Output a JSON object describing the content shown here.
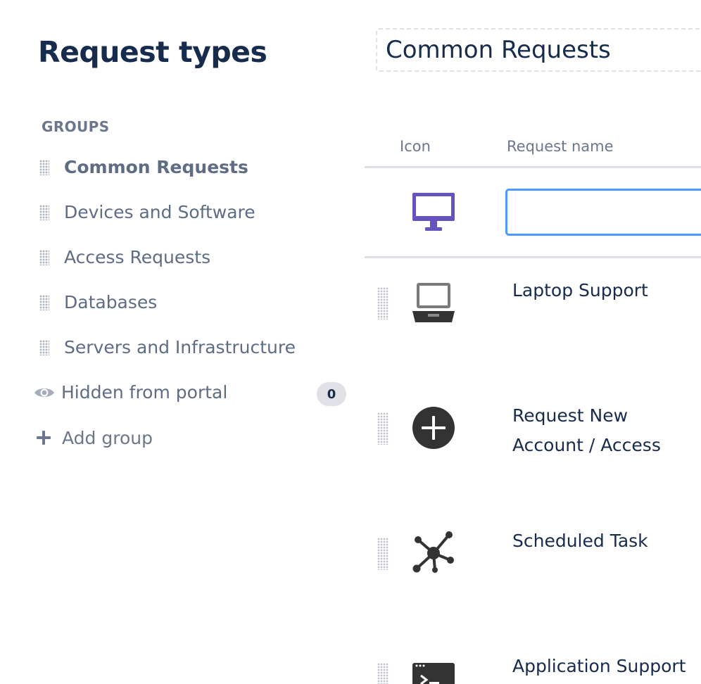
{
  "sidebar": {
    "title": "Request types",
    "groups_heading": "GROUPS",
    "groups": [
      {
        "label": "Common Requests",
        "active": true
      },
      {
        "label": "Devices and Software"
      },
      {
        "label": "Access Requests"
      },
      {
        "label": "Databases"
      },
      {
        "label": "Servers and Infrastructure"
      }
    ],
    "hidden": {
      "label": "Hidden from portal",
      "count": "0"
    },
    "add_group_label": "Add group"
  },
  "main": {
    "group_name": "Common Requests",
    "columns": {
      "icon": "Icon",
      "name": "Request name"
    },
    "new_request": {
      "icon": "desktop-monitor-icon",
      "name_value": "",
      "icon_color": "#6554c0"
    },
    "requests": [
      {
        "icon": "laptop-icon",
        "name": "Laptop Support"
      },
      {
        "icon": "plus-circle-icon",
        "name": "Request New Account / Access"
      },
      {
        "icon": "network-hub-icon",
        "name": "Scheduled Task"
      },
      {
        "icon": "terminal-icon",
        "name": "Application Support"
      }
    ]
  },
  "colors": {
    "title": "#172b4d",
    "muted": "#5e6c84",
    "subtle": "#6b778c",
    "rule": "#dfe1e6",
    "focus": "#4c9aff",
    "badge_bg": "#dfe1e6"
  }
}
